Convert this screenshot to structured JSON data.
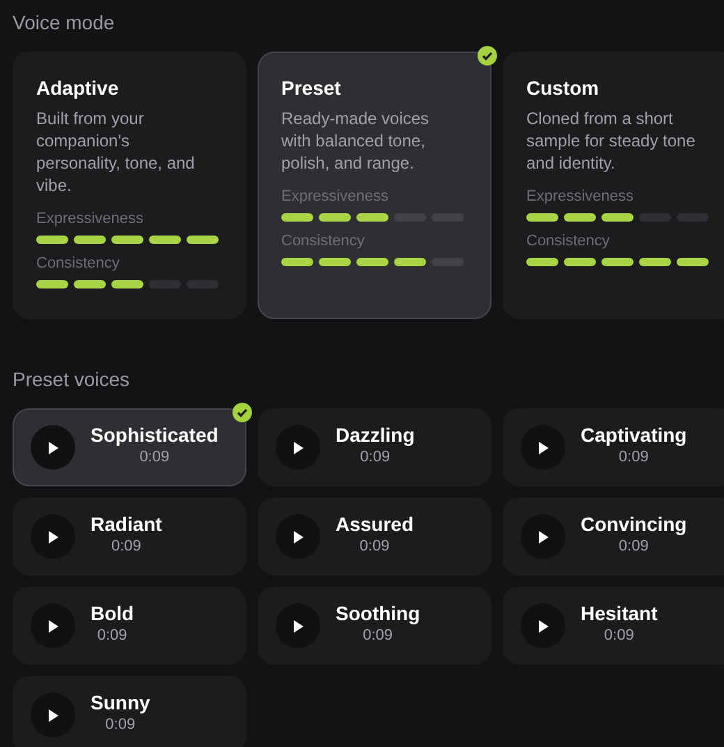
{
  "voice_mode": {
    "title": "Voice mode",
    "cards": [
      {
        "title": "Adaptive",
        "description": "Built from your companion's personality, tone, and vibe.",
        "selected": false,
        "meters": [
          {
            "label": "Expressiveness",
            "stars": 5
          },
          {
            "label": "Consistency",
            "stars": 3
          }
        ]
      },
      {
        "title": "Preset",
        "description": "Ready-made voices with balanced tone, polish, and range.",
        "selected": true,
        "meters": [
          {
            "label": "Expressiveness",
            "stars": 3
          },
          {
            "label": "Consistency",
            "stars": 4
          }
        ]
      },
      {
        "title": "Custom",
        "description": "Cloned from a short sample for steady tone and identity.",
        "selected": false,
        "meters": [
          {
            "label": "Expressiveness",
            "stars": 3
          },
          {
            "label": "Consistency",
            "stars": 5
          }
        ]
      }
    ]
  },
  "preset_voices": {
    "title": "Preset voices",
    "voices": [
      {
        "name": "Sophisticated",
        "duration": "0:09",
        "selected": true
      },
      {
        "name": "Dazzling",
        "duration": "0:09",
        "selected": false
      },
      {
        "name": "Captivating",
        "duration": "0:09",
        "selected": false
      },
      {
        "name": "Radiant",
        "duration": "0:09",
        "selected": false
      },
      {
        "name": "Assured",
        "duration": "0:09",
        "selected": false
      },
      {
        "name": "Convincing",
        "duration": "0:09",
        "selected": false
      },
      {
        "name": "Bold",
        "duration": "0:09",
        "selected": false
      },
      {
        "name": "Soothing",
        "duration": "0:09",
        "selected": false
      },
      {
        "name": "Hesitant",
        "duration": "0:09",
        "selected": false
      },
      {
        "name": "Sunny",
        "duration": "0:09",
        "selected": false
      }
    ]
  }
}
